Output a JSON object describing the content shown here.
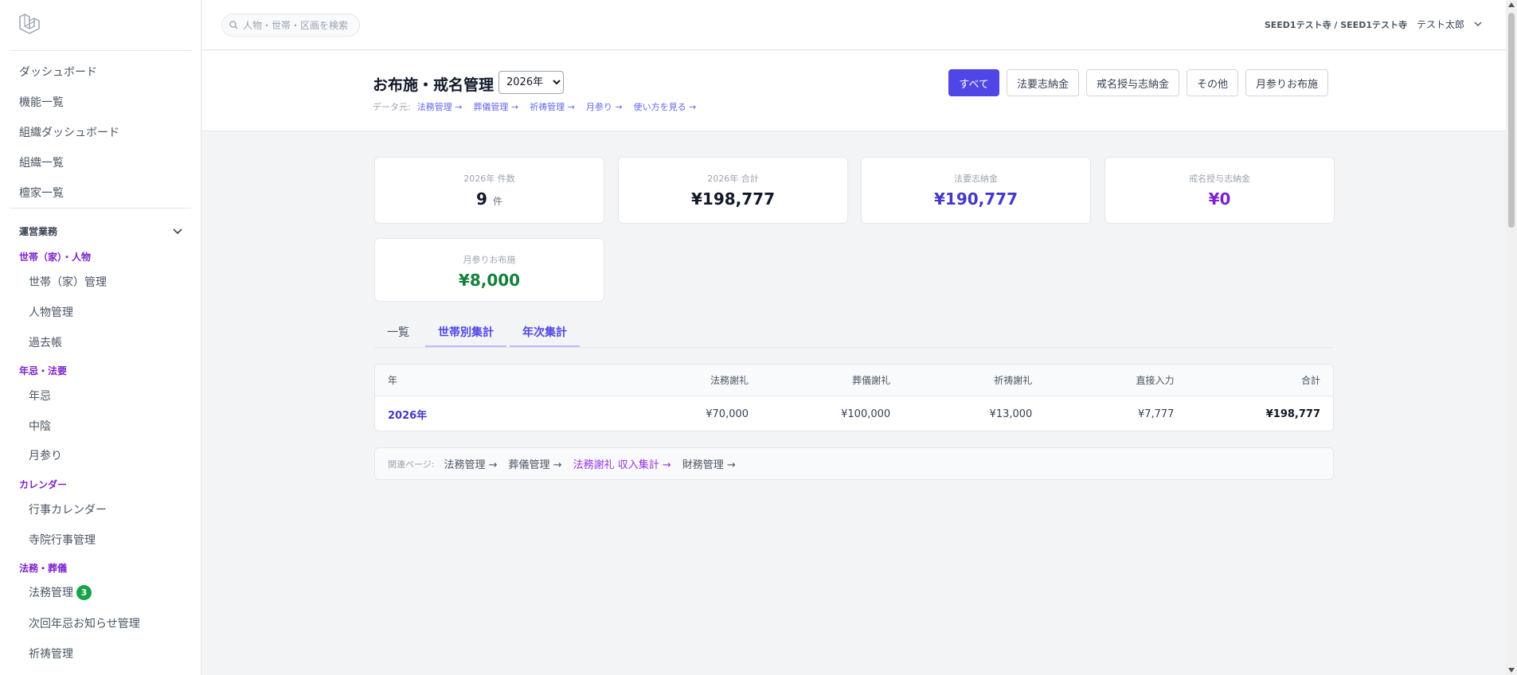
{
  "sidebar": {
    "top_items": [
      "ダッシュボード",
      "機能一覧",
      "組織ダッシュボード",
      "組織一覧",
      "檀家一覧"
    ],
    "section_title": "運営業務",
    "groups": [
      {
        "label": "世帯（家）・人物",
        "items": [
          "世帯（家）管理",
          "人物管理",
          "過去帳"
        ]
      },
      {
        "label": "年忌・法要",
        "items": [
          "年忌",
          "中陰",
          "月参り"
        ]
      },
      {
        "label": "カレンダー",
        "items": [
          "行事カレンダー",
          "寺院行事管理"
        ]
      },
      {
        "label": "法務・葬儀",
        "items": [
          "法務管理",
          "次回年忌お知らせ管理",
          "祈祷管理"
        ]
      }
    ],
    "badge_count": "3"
  },
  "topbar": {
    "search_placeholder": "人物・世帯・区画を検索",
    "org": "SEED1テスト寺 / SEED1テスト寺",
    "user": "テスト太郎"
  },
  "header": {
    "title": "お布施・戒名管理",
    "year_selected": "2026年",
    "source_label": "データ元:",
    "source_links": [
      "法務管理 →",
      "葬儀管理 →",
      "祈祷管理 →",
      "月参り →",
      "使い方を見る →"
    ],
    "filters": [
      "すべて",
      "法要志納金",
      "戒名授与志納金",
      "その他",
      "月参りお布施"
    ]
  },
  "stats": [
    {
      "label": "2026年 件数",
      "value": "9",
      "unit": "件",
      "color": "#111827"
    },
    {
      "label": "2026年 合計",
      "value": "¥198,777",
      "unit": "",
      "color": "#111827"
    },
    {
      "label": "法要志納金",
      "value": "¥190,777",
      "unit": "",
      "color": "#4338ca"
    },
    {
      "label": "戒名授与志納金",
      "value": "¥0",
      "unit": "",
      "color": "#7e22ce"
    },
    {
      "label": "月参りお布施",
      "value": "¥8,000",
      "unit": "",
      "color": "#15803d"
    }
  ],
  "tabs": [
    "一覧",
    "世帯別集計",
    "年次集計"
  ],
  "table": {
    "headers": [
      "年",
      "法務謝礼",
      "葬儀謝礼",
      "祈祷謝礼",
      "直接入力",
      "合計"
    ],
    "rows": [
      [
        "2026年",
        "¥70,000",
        "¥100,000",
        "¥13,000",
        "¥7,777",
        "¥198,777"
      ]
    ]
  },
  "related": {
    "label": "関連ページ:",
    "links": [
      "法務管理 →",
      "葬儀管理 →",
      "法務謝礼 収入集計 →",
      "財務管理 →"
    ]
  },
  "colors": {
    "accent": "#4f46e5",
    "group_label": "#7e22ce",
    "badge": "#16a34a"
  }
}
